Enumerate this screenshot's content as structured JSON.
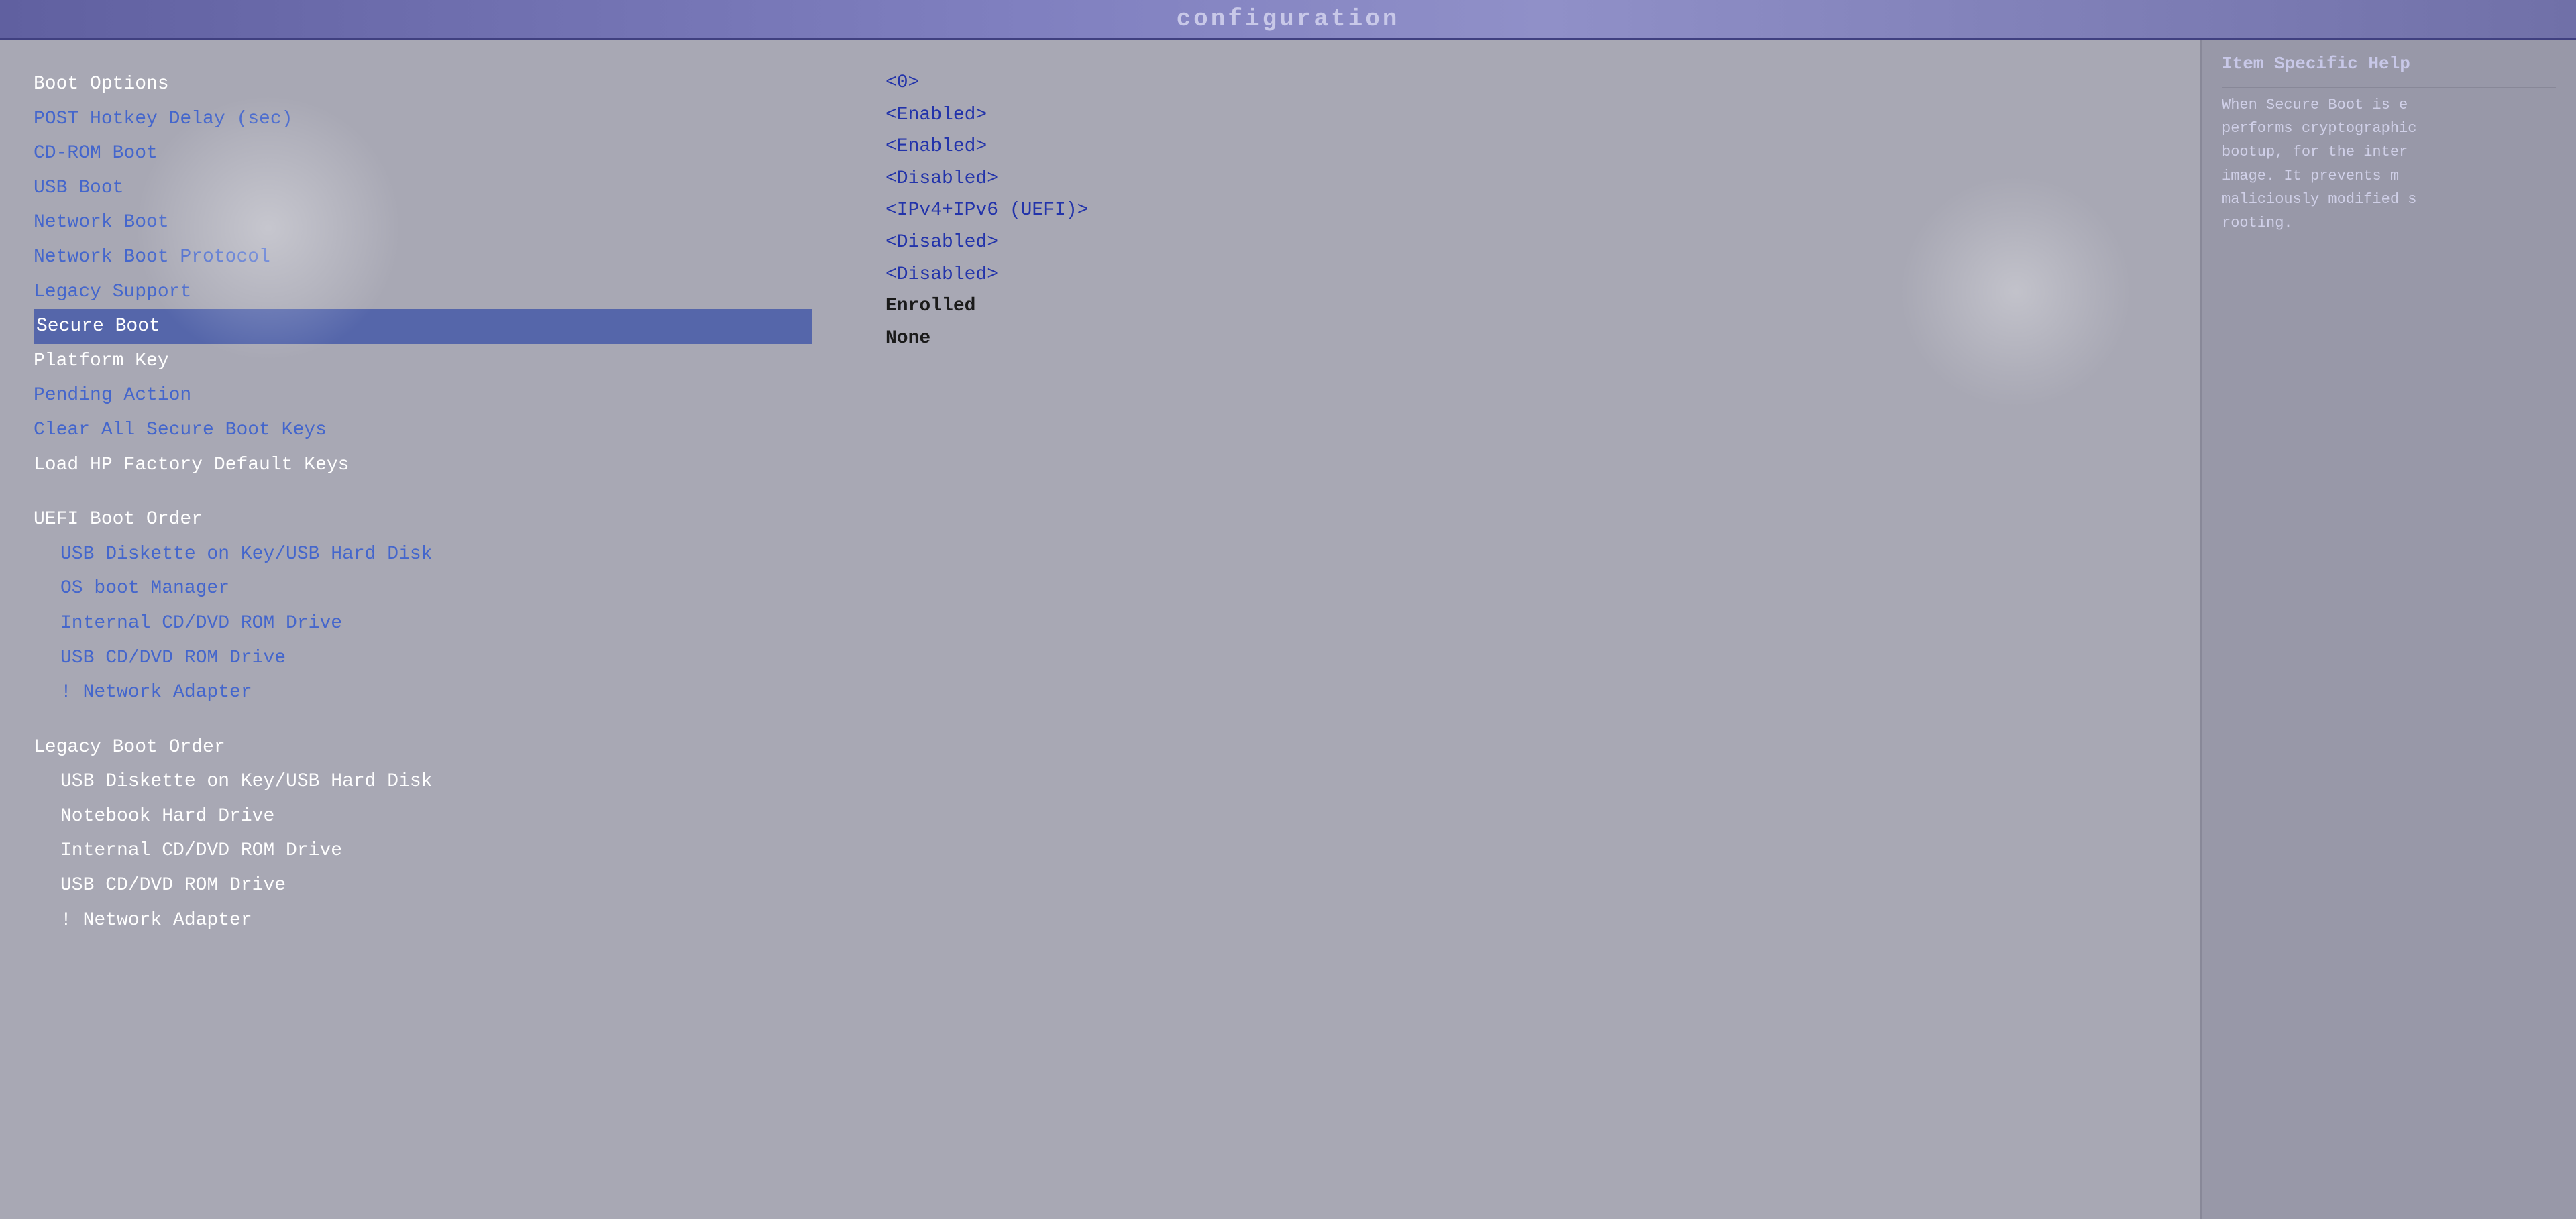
{
  "titleBar": {
    "text": "configuration"
  },
  "helpPanel": {
    "title": "Item Specific Help",
    "text": "When Secure Boot is e performs cryptographic bootup, for the inter image. It prevents m maliciously modified s rooting."
  },
  "menuItems": [
    {
      "label": "Boot Options",
      "style": "white",
      "indent": false
    },
    {
      "label": "POST Hotkey Delay (sec)",
      "style": "blue",
      "indent": false
    },
    {
      "label": "CD-ROM Boot",
      "style": "blue",
      "indent": false
    },
    {
      "label": "USB Boot",
      "style": "blue",
      "indent": false
    },
    {
      "label": "Network Boot",
      "style": "blue",
      "indent": false
    },
    {
      "label": "Network Boot Protocol",
      "style": "blue",
      "indent": false
    },
    {
      "label": "Legacy Support",
      "style": "blue",
      "indent": false
    },
    {
      "label": "Secure Boot",
      "style": "selected",
      "indent": false
    },
    {
      "label": "Platform Key",
      "style": "white",
      "indent": false
    },
    {
      "label": "Pending Action",
      "style": "blue",
      "indent": false
    },
    {
      "label": "Clear All Secure Boot Keys",
      "style": "blue",
      "indent": false
    },
    {
      "label": "Load HP Factory Default Keys",
      "style": "white",
      "indent": false
    },
    {
      "label": "",
      "style": "gap",
      "indent": false
    },
    {
      "label": "UEFI Boot Order",
      "style": "white",
      "indent": false
    },
    {
      "label": "USB Diskette on Key/USB Hard Disk",
      "style": "blue",
      "indent": true
    },
    {
      "label": "OS boot Manager",
      "style": "blue",
      "indent": true
    },
    {
      "label": "Internal CD/DVD ROM Drive",
      "style": "blue",
      "indent": true
    },
    {
      "label": "USB CD/DVD ROM Drive",
      "style": "blue",
      "indent": true
    },
    {
      "label": "! Network Adapter",
      "style": "blue",
      "indent": true
    },
    {
      "label": "",
      "style": "gap",
      "indent": false
    },
    {
      "label": "Legacy Boot Order",
      "style": "white",
      "indent": false
    },
    {
      "label": "USB Diskette on Key/USB Hard Disk",
      "style": "white",
      "indent": true
    },
    {
      "label": "Notebook Hard Drive",
      "style": "white",
      "indent": true
    },
    {
      "label": "Internal CD/DVD ROM Drive",
      "style": "white",
      "indent": true
    },
    {
      "label": "USB CD/DVD ROM Drive",
      "style": "white",
      "indent": true
    },
    {
      "label": "! Network Adapter",
      "style": "white",
      "indent": true
    }
  ],
  "values": [
    {
      "label": "<0>",
      "style": "blue"
    },
    {
      "label": "<Enabled>",
      "style": "blue"
    },
    {
      "label": "<Enabled>",
      "style": "blue"
    },
    {
      "label": "<Disabled>",
      "style": "blue"
    },
    {
      "label": "<IPv4+IPv6 (UEFI)>",
      "style": "blue"
    },
    {
      "label": "<Disabled>",
      "style": "blue"
    },
    {
      "label": "<Disabled>",
      "style": "blue"
    },
    {
      "label": "Enrolled",
      "style": "bold"
    },
    {
      "label": "None",
      "style": "bold"
    }
  ],
  "colors": {
    "background": "#a8a8b4",
    "titleBg": "#6870a8",
    "selectedBg": "#5566aa",
    "textBlue": "#4466cc",
    "textWhite": "#ffffff",
    "helpBg": "#9898a8"
  }
}
